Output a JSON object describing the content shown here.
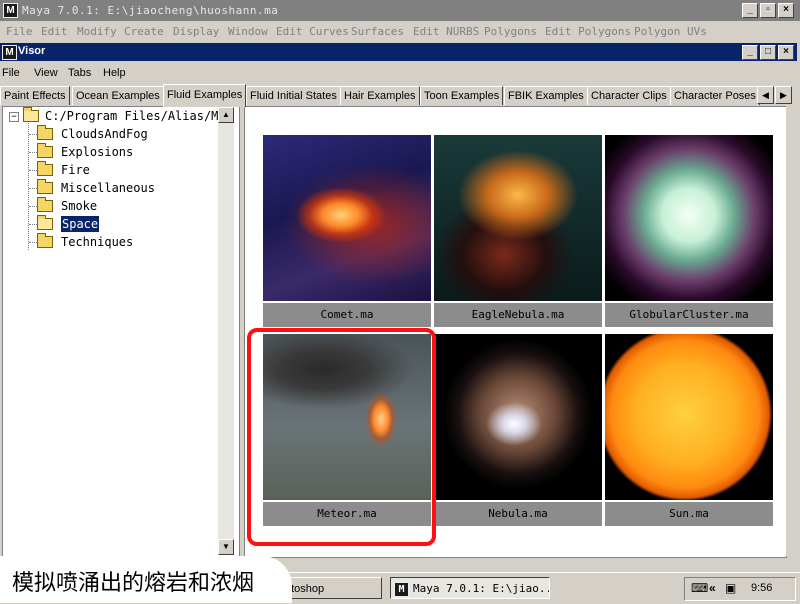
{
  "maya_window": {
    "title": "Maya 7.0.1: E:\\jiaocheng\\huoshann.ma",
    "logo": "M",
    "menu": [
      "File",
      "Edit",
      "Modify",
      "Create",
      "Display",
      "Window",
      "Edit Curves",
      "Surfaces",
      "Edit NURBS",
      "Polygons",
      "Edit Polygons",
      "Polygon UVs"
    ]
  },
  "visor": {
    "title": "Visor",
    "menu": [
      "File",
      "View",
      "Tabs",
      "Help"
    ],
    "tabs": [
      "Paint Effects",
      "Ocean Examples",
      "Fluid Examples",
      "Fluid Initial States",
      "Hair Examples",
      "Toon Examples",
      "FBIK Examples",
      "Character Clips",
      "Character Poses"
    ],
    "active_tab": "Fluid Examples"
  },
  "tree": {
    "root": "C:/Program Files/Alias/M",
    "items": [
      "CloudsAndFog",
      "Explosions",
      "Fire",
      "Miscellaneous",
      "Smoke",
      "Space",
      "Techniques"
    ],
    "selected": "Space"
  },
  "grid": {
    "items": [
      {
        "name": "Comet.ma",
        "icon": "comet-thumbnail"
      },
      {
        "name": "EagleNebula.ma",
        "icon": "eagle-nebula-thumbnail"
      },
      {
        "name": "GlobularCluster.ma",
        "icon": "globular-cluster-thumbnail"
      },
      {
        "name": "Meteor.ma",
        "icon": "meteor-thumbnail"
      },
      {
        "name": "Nebula.ma",
        "icon": "nebula-thumbnail"
      },
      {
        "name": "Sun.ma",
        "icon": "sun-thumbnail"
      }
    ],
    "highlighted": "Meteor.ma",
    "highlight_color": "#ff1010"
  },
  "taskbar": {
    "tasks": [
      "otoshop",
      "Maya 7.0.1: E:\\jiao..."
    ],
    "clock": "9:56"
  },
  "caption": "模拟喷涌出的熔岩和浓烟",
  "colors": {
    "title_active": "#0a246a",
    "title_inactive": "#808080",
    "face": "#d4d0c8",
    "selection": "#0a246a"
  }
}
